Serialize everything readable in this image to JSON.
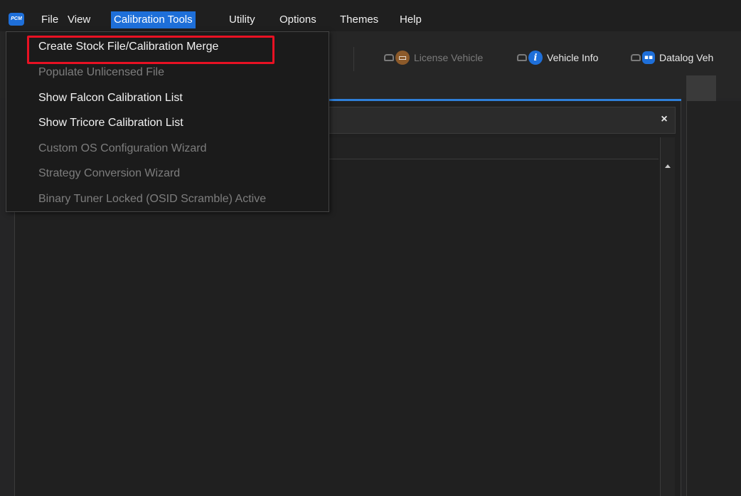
{
  "app": {
    "logo_text": "PCM"
  },
  "menubar": {
    "items": [
      {
        "label": "File"
      },
      {
        "label": "View"
      },
      {
        "label": "Calibration Tools",
        "active": true
      },
      {
        "label": "Utility"
      },
      {
        "label": "Options"
      },
      {
        "label": "Themes"
      },
      {
        "label": "Help"
      }
    ]
  },
  "toolbar": {
    "license_vehicle": "License Vehicle",
    "vehicle_info": "Vehicle Info",
    "vehicle_info_icon_glyph": "i",
    "datalog_vehicle": "Datalog Veh"
  },
  "panel": {
    "close_glyph": "×"
  },
  "dropdown": {
    "items": [
      {
        "label": "Create Stock File/Calibration Merge",
        "enabled": true
      },
      {
        "label": "Populate Unlicensed File",
        "enabled": false
      },
      {
        "label": "Show Falcon Calibration List",
        "enabled": true
      },
      {
        "label": "Show Tricore Calibration List",
        "enabled": true
      },
      {
        "label": "Custom OS Configuration Wizard",
        "enabled": false
      },
      {
        "label": "Strategy Conversion Wizard",
        "enabled": false
      },
      {
        "label": "Binary Tuner Locked (OSID Scramble) Active",
        "enabled": false
      }
    ]
  },
  "colors": {
    "accent": "#1e6fd9",
    "highlight": "#e81123",
    "background": "#252526"
  }
}
